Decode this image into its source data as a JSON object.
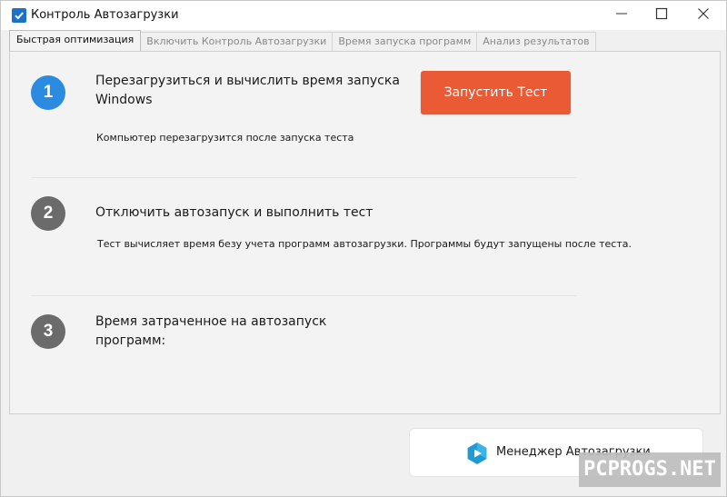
{
  "window": {
    "title": "Контроль Автозагрузки"
  },
  "tabs": [
    {
      "label": "Быстрая оптимизация",
      "active": true
    },
    {
      "label": "Включить Контроль Автозагрузки",
      "active": false
    },
    {
      "label": "Время запуска программ",
      "active": false
    },
    {
      "label": "Анализ результатов",
      "active": false
    }
  ],
  "steps": [
    {
      "number": "1",
      "title_line1": "Перезагрузиться и вычислить время запуска",
      "title_line2": "Windows",
      "description": "Компьютер перезагрузится после запуска теста"
    },
    {
      "number": "2",
      "title_line1": "Отключить автозапуск и выполнить тест",
      "description": "Тест вычисляет время безу учета программ автозагрузки. Программы будут запущены после теста."
    },
    {
      "number": "3",
      "title_line1": "Время затраченное на автозапуск",
      "title_line2": "программ:"
    }
  ],
  "run_button": {
    "label": "Запустить Тест"
  },
  "manager_button": {
    "label": "Менеджер Автозагрузки"
  },
  "watermark": {
    "text": "PCPROGS.NET"
  },
  "colors": {
    "accent_orange": "#ea5a34",
    "step_active_blue": "#2a8be0",
    "step_inactive_gray": "#6b6b6b",
    "app_icon_blue": "#1a73c8"
  },
  "icons": {
    "app": "checkbox-icon",
    "minimize": "minimize-icon",
    "maximize": "maximize-icon",
    "close": "close-icon",
    "manager": "play-hexagon-icon"
  }
}
